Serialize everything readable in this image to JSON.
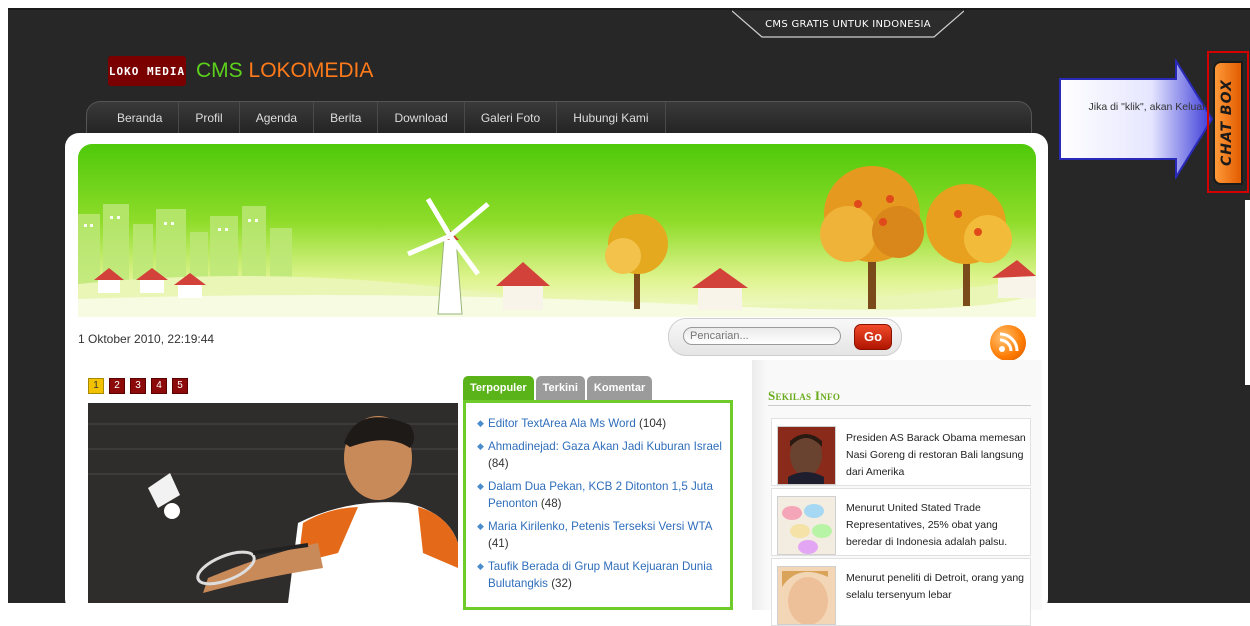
{
  "top_bar": {
    "tagline": "CMS GRATIS UNTUK INDONESIA"
  },
  "logo": {
    "mark_text": "LOKO MEDIA",
    "cms": "CMS",
    "name": "LOKOMEDIA"
  },
  "nav": {
    "items": [
      {
        "label": "Beranda"
      },
      {
        "label": "Profil"
      },
      {
        "label": "Agenda"
      },
      {
        "label": "Berita"
      },
      {
        "label": "Download"
      },
      {
        "label": "Galeri Foto"
      },
      {
        "label": "Hubungi Kami"
      }
    ]
  },
  "datetime": "1 Oktober 2010, 22:19:44",
  "search": {
    "placeholder": "Pencarian...",
    "button_label": "Go"
  },
  "slider": {
    "pages": [
      "1",
      "2",
      "3",
      "4",
      "5"
    ],
    "active_page": "1"
  },
  "tabs": {
    "items": [
      {
        "label": "Terpopuler",
        "active": true
      },
      {
        "label": "Terkini",
        "active": false
      },
      {
        "label": "Komentar",
        "active": false
      }
    ]
  },
  "popular": [
    {
      "title": "Editor TextArea Ala Ms Word",
      "count": "(104)"
    },
    {
      "title": "Ahmadinejad: Gaza Akan Jadi Kuburan Israel",
      "count": "(84)"
    },
    {
      "title": "Dalam Dua Pekan, KCB 2 Ditonton 1,5 Juta Penonton",
      "count": "(48)"
    },
    {
      "title": "Maria Kirilenko, Petenis Terseksi Versi WTA",
      "count": "(41)"
    },
    {
      "title": "Taufik Berada di Grup Maut Kejuaran Dunia Bulutangkis",
      "count": "(32)"
    }
  ],
  "sekilas_info": {
    "title": "Sekilas Info",
    "items": [
      {
        "text": "Presiden AS Barack Obama memesan Nasi Goreng di restoran Bali langsung dari Amerika"
      },
      {
        "text": "Menurut United Stated Trade Representatives, 25% obat yang beredar di Indonesia adalah palsu."
      },
      {
        "text": "Menurut peneliti di Detroit, orang yang selalu tersenyum lebar"
      }
    ]
  },
  "chat": {
    "hint": "Jika di \"klik\", akan Keluar.",
    "label": "CHAT BOX"
  },
  "colors": {
    "accent_green": "#5bb31a",
    "brand_orange": "#ff7a1a",
    "pager_red": "#8c0a0a",
    "pager_active": "#f2c200"
  }
}
